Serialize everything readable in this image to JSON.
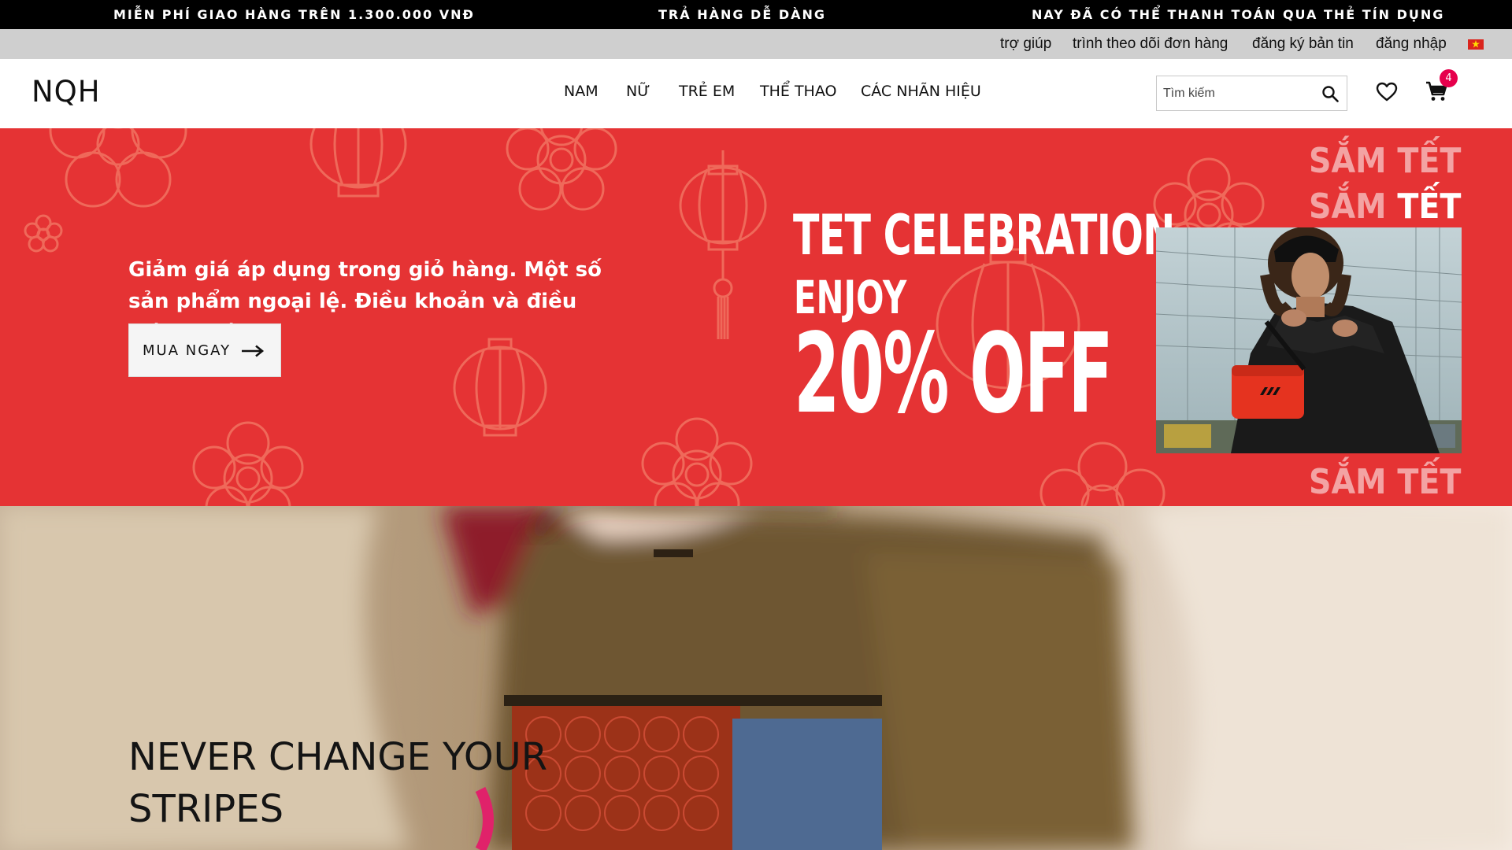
{
  "promo_bar": {
    "items": [
      "MIỄN PHÍ GIAO HÀNG TRÊN 1.300.000 VNĐ",
      "TRẢ HÀNG DỄ DÀNG",
      "NAY ĐÃ CÓ THỂ THANH TOÁN QUA THẺ TÍN DỤNG"
    ]
  },
  "utility_bar": {
    "links": [
      "trợ giúp",
      "trình theo dõi đơn hàng",
      "đăng ký bản tin",
      "đăng nhập"
    ],
    "flag_icon": "vietnam-flag-icon"
  },
  "header": {
    "logo": "NQH",
    "nav": [
      "NAM",
      "NỮ",
      "TRẺ EM",
      "THỂ THAO",
      "CÁC NHÃN HIỆU"
    ],
    "search_placeholder": "Tìm kiếm",
    "cart_count": "4",
    "icons": [
      "search-icon",
      "heart-icon",
      "cart-icon"
    ]
  },
  "hero": {
    "description": "Giảm giá áp dụng trong giỏ hàng. Một số sản phẩm ngoại lệ. Điều khoản và điều kiện đi kèm.",
    "cta_label": "MUA NGAY",
    "title": "TET CELEBRATION",
    "enjoy": "ENJOY",
    "offer": "20% OFF",
    "sam_tet_line1": "SẮM TẾT",
    "sam_tet_line2_a": "SẮM ",
    "sam_tet_line2_b": "TẾT",
    "sam_tet_line3": "SẮM TẾT",
    "background_color": "#e53334"
  },
  "banner2": {
    "title_line1": "NEVER CHANGE YOUR",
    "title_line2": "STRIPES"
  }
}
